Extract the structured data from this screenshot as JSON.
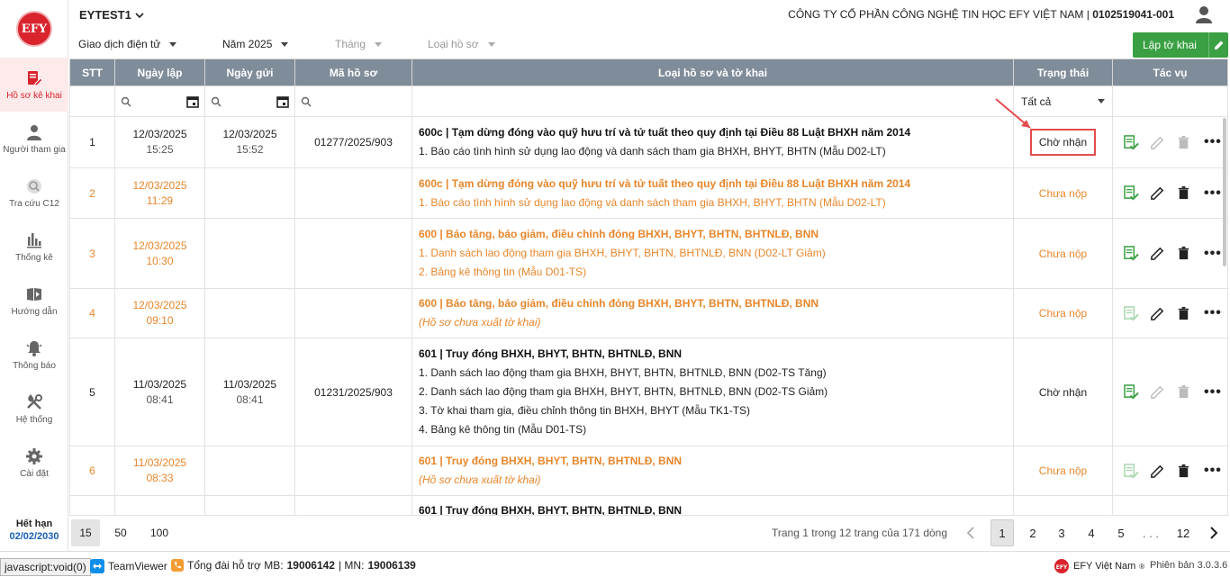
{
  "logo": "EFY",
  "sidebar": {
    "items": [
      {
        "label": "Hồ sơ kê khai",
        "icon": "document-edit-icon"
      },
      {
        "label": "Người tham gia",
        "icon": "person-icon"
      },
      {
        "label": "Tra cứu C12",
        "icon": "search-doc-icon"
      },
      {
        "label": "Thống kê",
        "icon": "bar-chart-icon"
      },
      {
        "label": "Hướng dẫn",
        "icon": "video-guide-icon"
      },
      {
        "label": "Thông báo",
        "icon": "bell-icon"
      },
      {
        "label": "Hệ thống",
        "icon": "tools-icon"
      },
      {
        "label": "Cài đặt",
        "icon": "gear-icon"
      }
    ],
    "expire_label": "Hết hạn",
    "expire_date": "02/02/2030"
  },
  "header": {
    "tenant": "EYTEST1",
    "company": "CÔNG TY CỔ PHẦN CÔNG NGHỆ TIN HỌC EFY VIỆT NAM |",
    "tax_code": "0102519041-001"
  },
  "filters": {
    "type": "Giao dịch điện tử",
    "year": "Năm 2025",
    "month": "Tháng",
    "profile_type": "Loại hồ sơ",
    "create_label": "Lập tờ khai"
  },
  "table": {
    "columns": [
      "STT",
      "Ngày lập",
      "Ngày gửi",
      "Mã hồ sơ",
      "Loại hồ sơ và tờ khai",
      "Trạng thái",
      "Tác vụ"
    ],
    "status_filter": "Tất cả",
    "rows": [
      {
        "stt": "1",
        "created_date": "12/03/2025",
        "created_time": "15:25",
        "sent_date": "12/03/2025",
        "sent_time": "15:52",
        "code": "01277/2025/903",
        "title": "600c | Tạm dừng đóng vào quỹ hưu trí và tử tuất theo quy định tại Điều 88 Luật BHXH năm 2014",
        "lines": [
          "1. Báo cáo tình hình sử dụng lao động và danh sách tham gia BHXH, BHYT, BHTN (Mẫu D02-LT)"
        ],
        "status": "Chờ nhận"
      },
      {
        "stt": "2",
        "created_date": "12/03/2025",
        "created_time": "11:29",
        "sent_date": "",
        "sent_time": "",
        "code": "",
        "title": "600c | Tạm dừng đóng vào quỹ hưu trí và tử tuất theo quy định tại Điều 88 Luật BHXH năm 2014",
        "lines": [
          "1. Báo cáo tình hình sử dụng lao động và danh sách tham gia BHXH, BHYT, BHTN (Mẫu D02-LT)"
        ],
        "status": "Chưa nộp"
      },
      {
        "stt": "3",
        "created_date": "12/03/2025",
        "created_time": "10:30",
        "sent_date": "",
        "sent_time": "",
        "code": "",
        "title": "600 | Báo tăng, báo giảm, điều chỉnh đóng BHXH, BHYT, BHTN, BHTNLĐ, BNN",
        "lines": [
          "1. Danh sách lao động tham gia BHXH, BHYT, BHTN, BHTNLĐ, BNN (D02-LT Giảm)",
          "2. Bảng kê thông tin (Mẫu D01-TS)"
        ],
        "status": "Chưa nộp"
      },
      {
        "stt": "4",
        "created_date": "12/03/2025",
        "created_time": "09:10",
        "sent_date": "",
        "sent_time": "",
        "code": "",
        "title": "600 | Báo tăng, báo giảm, điều chỉnh đóng BHXH, BHYT, BHTN, BHTNLĐ, BNN",
        "note": "(Hồ sơ chưa xuất tờ khai)",
        "status": "Chưa nộp"
      },
      {
        "stt": "5",
        "created_date": "11/03/2025",
        "created_time": "08:41",
        "sent_date": "11/03/2025",
        "sent_time": "08:41",
        "code": "01231/2025/903",
        "title": "601 | Truy đóng BHXH, BHYT, BHTN, BHTNLĐ, BNN",
        "lines": [
          "1. Danh sách lao động tham gia BHXH, BHYT, BHTN, BHTNLĐ, BNN (D02-TS Tăng)",
          "2. Danh sách lao động tham gia BHXH, BHYT, BHTN, BHTNLĐ, BNN (D02-TS Giảm)",
          "3. Tờ khai tham gia, điều chỉnh thông tin BHXH, BHYT (Mẫu TK1-TS)",
          "4. Bảng kê thông tin (Mẫu D01-TS)"
        ],
        "status": "Chờ nhận"
      },
      {
        "stt": "6",
        "created_date": "11/03/2025",
        "created_time": "08:33",
        "sent_date": "",
        "sent_time": "",
        "code": "",
        "title": "601 | Truy đóng BHXH, BHYT, BHTN, BHTNLĐ, BNN",
        "note": "(Hồ sơ chưa xuất tờ khai)",
        "status": "Chưa nộp"
      },
      {
        "stt": "",
        "created_date": "",
        "created_time": "",
        "sent_date": "",
        "sent_time": "",
        "code": "",
        "title": "601 | Truy đóng BHXH, BHYT, BHTN, BHTNLĐ, BNN",
        "status": ""
      }
    ]
  },
  "pagination": {
    "sizes": [
      "15",
      "50",
      "100"
    ],
    "info": "Trang 1 trong 12 trang của 171 dòng",
    "pages": [
      "1",
      "2",
      "3",
      "4",
      "5",
      ". . .",
      "12"
    ]
  },
  "footer": {
    "status_url": "javascript:void(0)",
    "teamviewer": "TeamViewer",
    "hotline_prefix": "Tổng đài hỗ trợ MB:",
    "hotline_mb": "19006142",
    "hotline_sep": "| MN:",
    "hotline_mn": "19006139",
    "brand": "EFY Việt Nam",
    "version": "Phiên bản 3.0.3.6"
  },
  "colors": {
    "accent": "#d9232d",
    "pending": "#e8862b",
    "create": "#3aa043",
    "header": "#7f8c99"
  }
}
